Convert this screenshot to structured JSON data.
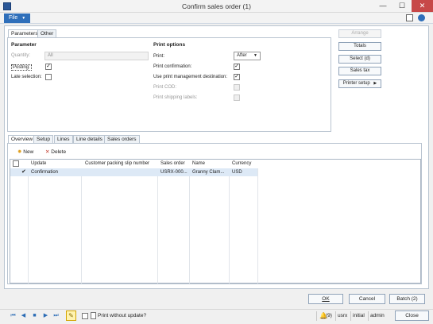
{
  "window": {
    "title": "Confirm sales order (1)",
    "minimize_glyph": "—",
    "maximize_glyph": "☐",
    "close_glyph": "✕"
  },
  "ribbon": {
    "file_label": "File",
    "file_caret": "▼"
  },
  "top_tabs": [
    "Parameters",
    "Other"
  ],
  "parameter": {
    "header": "Parameter",
    "quantity_label": "Quantity:",
    "quantity_value": "All",
    "posting_label": "Posting:",
    "posting_checked": true,
    "late_selection_label": "Late selection:",
    "late_selection_checked": false
  },
  "print_options": {
    "header": "Print options",
    "print_label": "Print:",
    "print_value": "After",
    "print_confirmation_label": "Print confirmation:",
    "print_confirmation_checked": true,
    "use_pm_label": "Use print management destination:",
    "use_pm_checked": true,
    "print_cod_label": "Print COD:",
    "print_shipping_label": "Print shipping labels:"
  },
  "side_buttons": {
    "arrange": "Arrange",
    "totals": "Totals",
    "select": "Select (d)",
    "sales_tax": "Sales tax",
    "printer_setup": "Printer setup",
    "printer_caret": "▶"
  },
  "bottom_tabs": [
    "Overview",
    "Setup",
    "Lines",
    "Line details",
    "Sales orders"
  ],
  "toolbar": {
    "new_label": "New",
    "delete_label": "Delete"
  },
  "grid": {
    "columns": [
      "Update",
      "Customer packing slip number",
      "Sales order",
      "Name",
      "Currency"
    ],
    "rows": [
      {
        "check": "✔",
        "update": "Confirmation",
        "packing_slip": "",
        "sales_order": "USRX-000...",
        "name": "Granny Clam...",
        "currency": "USD"
      }
    ]
  },
  "buttons": {
    "ok": "OK",
    "cancel": "Cancel",
    "batch": "Batch (2)"
  },
  "statusbar": {
    "print_without_update": "Print without update?",
    "notifications": "(9)",
    "user": "usrx",
    "partition": "initial",
    "role": "admin",
    "close": "Close"
  },
  "colors": {
    "accent": "#2f6fba",
    "selected_row": "#dde9f6",
    "close_button": "#c74848"
  }
}
